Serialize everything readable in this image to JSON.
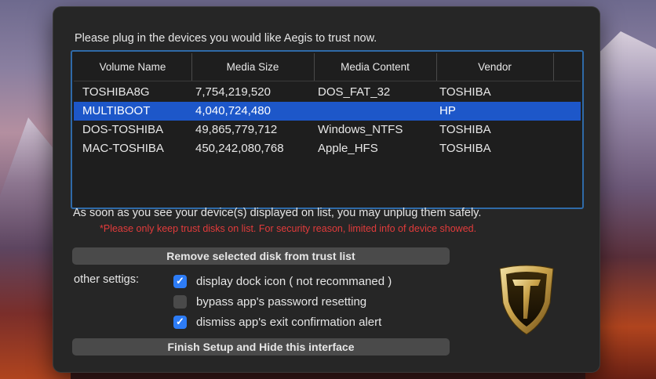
{
  "dialog": {
    "prompt": "Please plug in the devices you would like Aegis to trust now.",
    "info": "As soon as you see your device(s) displayed on list, you may unplug them safely.",
    "warning": "*Please only keep trust disks on list. For security reason, limited info of device showed.",
    "remove_button": "Remove selected disk from trust list",
    "finish_button": "Finish Setup and Hide this interface",
    "other_settings_label": "other settigs:"
  },
  "table": {
    "columns": [
      "Volume Name",
      "Media Size",
      "Media Content",
      "Vendor"
    ],
    "rows": [
      {
        "volume": "TOSHIBA8G",
        "size": "7,754,219,520",
        "content": "DOS_FAT_32",
        "vendor": "TOSHIBA",
        "selected": false
      },
      {
        "volume": "MULTIBOOT",
        "size": "4,040,724,480",
        "content": "",
        "vendor": "HP",
        "selected": true
      },
      {
        "volume": "DOS-TOSHIBA",
        "size": "49,865,779,712",
        "content": "Windows_NTFS",
        "vendor": "TOSHIBA",
        "selected": false
      },
      {
        "volume": "MAC-TOSHIBA",
        "size": "450,242,080,768",
        "content": "Apple_HFS",
        "vendor": "TOSHIBA",
        "selected": false
      }
    ]
  },
  "options": [
    {
      "label": "display dock icon ( not recommaned )",
      "checked": true
    },
    {
      "label": "bypass app's password resetting",
      "checked": false
    },
    {
      "label": "dismiss app's exit confirmation alert",
      "checked": true
    }
  ],
  "colors": {
    "accent": "#1d57c9",
    "checkbox_on": "#2d7cf6",
    "warning": "#e23b3b",
    "shield_gold": "#c9a24a"
  },
  "icons": {
    "logo": "aegis-shield-icon",
    "check": "checkmark-icon"
  }
}
